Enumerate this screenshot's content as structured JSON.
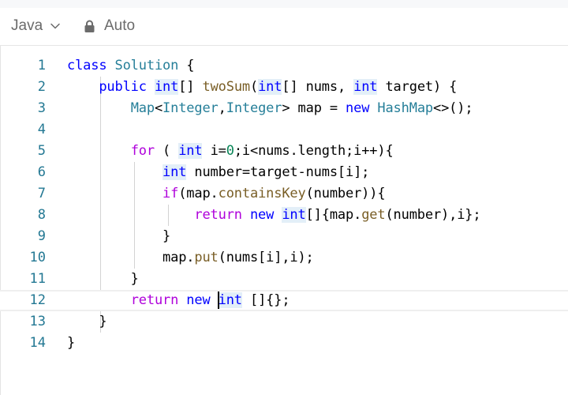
{
  "toolbar": {
    "language": "Java",
    "mode": "Auto",
    "language_icon": "chevron-down-icon",
    "mode_icon": "lock-icon"
  },
  "editor": {
    "line_numbers": [
      "1",
      "2",
      "3",
      "4",
      "5",
      "6",
      "7",
      "8",
      "9",
      "10",
      "11",
      "12",
      "13",
      "14"
    ],
    "lines": [
      [
        {
          "t": "class ",
          "c": "kw"
        },
        {
          "t": "Solution",
          "c": "ty"
        },
        {
          "t": " {",
          "c": "pl"
        }
      ],
      [
        {
          "t": "    ",
          "c": "pl"
        },
        {
          "t": "public ",
          "c": "kw"
        },
        {
          "t": "int",
          "c": "kw",
          "hl": true
        },
        {
          "t": "[] ",
          "c": "pl"
        },
        {
          "t": "twoSum",
          "c": "fn"
        },
        {
          "t": "(",
          "c": "pl"
        },
        {
          "t": "int",
          "c": "kw",
          "hl": true
        },
        {
          "t": "[] nums, ",
          "c": "pl"
        },
        {
          "t": "int",
          "c": "kw",
          "hl": true
        },
        {
          "t": " target) {",
          "c": "pl"
        }
      ],
      [
        {
          "t": "        ",
          "c": "pl"
        },
        {
          "t": "Map",
          "c": "ty"
        },
        {
          "t": "<",
          "c": "pl"
        },
        {
          "t": "Integer",
          "c": "ty"
        },
        {
          "t": ",",
          "c": "pl"
        },
        {
          "t": "Integer",
          "c": "ty"
        },
        {
          "t": "> map = ",
          "c": "pl"
        },
        {
          "t": "new ",
          "c": "kw"
        },
        {
          "t": "HashMap",
          "c": "ty"
        },
        {
          "t": "<>();",
          "c": "pl"
        }
      ],
      [],
      [
        {
          "t": "        ",
          "c": "pl"
        },
        {
          "t": "for",
          "c": "kw2"
        },
        {
          "t": " ( ",
          "c": "pl"
        },
        {
          "t": "int",
          "c": "kw",
          "hl": true
        },
        {
          "t": " i=",
          "c": "pl"
        },
        {
          "t": "0",
          "c": "num"
        },
        {
          "t": ";i<nums.length;i++){",
          "c": "pl"
        }
      ],
      [
        {
          "t": "            ",
          "c": "pl"
        },
        {
          "t": "int",
          "c": "kw",
          "hl": true
        },
        {
          "t": " number=target-nums[i];",
          "c": "pl"
        }
      ],
      [
        {
          "t": "            ",
          "c": "pl"
        },
        {
          "t": "if",
          "c": "kw2"
        },
        {
          "t": "(map.",
          "c": "pl"
        },
        {
          "t": "containsKey",
          "c": "fn"
        },
        {
          "t": "(number)){",
          "c": "pl"
        }
      ],
      [
        {
          "t": "                ",
          "c": "pl"
        },
        {
          "t": "return ",
          "c": "kw2"
        },
        {
          "t": "new ",
          "c": "kw"
        },
        {
          "t": "int",
          "c": "kw",
          "hl": true
        },
        {
          "t": "[]{map.",
          "c": "pl"
        },
        {
          "t": "get",
          "c": "fn"
        },
        {
          "t": "(number),i};",
          "c": "pl"
        }
      ],
      [
        {
          "t": "            }",
          "c": "pl"
        }
      ],
      [
        {
          "t": "            map.",
          "c": "pl"
        },
        {
          "t": "put",
          "c": "fn"
        },
        {
          "t": "(nums[i],i);",
          "c": "pl"
        }
      ],
      [
        {
          "t": "        }",
          "c": "pl"
        }
      ],
      [
        {
          "t": "        ",
          "c": "pl"
        },
        {
          "t": "return ",
          "c": "kw2"
        },
        {
          "t": "new ",
          "c": "kw"
        },
        {
          "t": "int",
          "c": "kw",
          "hl": true
        },
        {
          "t": " []{};",
          "c": "pl"
        }
      ],
      [
        {
          "t": "    }",
          "c": "pl"
        }
      ],
      [
        {
          "t": "}",
          "c": "pl"
        }
      ]
    ],
    "current_line": 12
  }
}
